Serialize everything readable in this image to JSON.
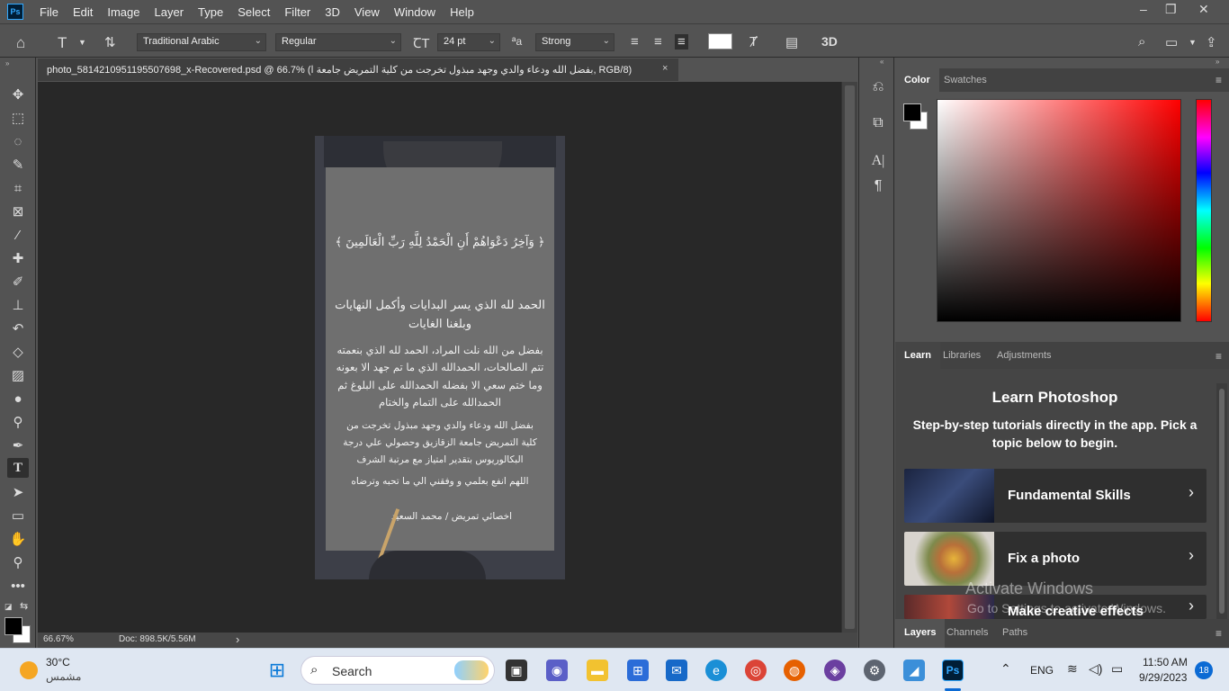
{
  "app": {
    "logo": "Ps",
    "menu": [
      "File",
      "Edit",
      "Image",
      "Layer",
      "Type",
      "Select",
      "Filter",
      "3D",
      "View",
      "Window",
      "Help"
    ],
    "window_controls": [
      "–",
      "❐",
      "✕"
    ]
  },
  "options_bar": {
    "font_family": "Traditional Arabic",
    "font_style": "Regular",
    "font_size": "24 pt",
    "antialias": "Strong",
    "aa_icon_text": "ªa",
    "color_swatch": "#ffffff",
    "label_3d": "3D"
  },
  "document": {
    "tab_title": "photo_5814210951195507698_x-Recovered.psd  @  66.7% (بفضل الله ودعاء والدي وجهد مبذول تخرجت من  كلية التمريض جامعة ا, RGB/8)",
    "close": "×",
    "zoom": "66.67%",
    "doc_size": "Doc: 898.5K/5.56M",
    "status_arrow": "›"
  },
  "artwork": {
    "verse": "﴿ وَآخِرُ دَعْوَاهُمْ أَنِ الْحَمْدُ لِلَّهِ رَبِّ الْعَالَمِينَ ﴾",
    "para1_line1": "الحمد لله الذي يسر البدايات وأكمل النهايات",
    "para1_line2": "وبلغنا الغايات",
    "para2_line1": "بفضل من الله نلت المراد، الحمد لله الذي بنعمته",
    "para2_line2": "تتم الصالحات، الحمدالله الذي ما تم جهد الا بعونه",
    "para2_line3": "وما ختم سعي الا بفضله الحمدالله على البلوغ ثم",
    "para2_line4": "الحمدالله على التمام والختام",
    "para3_line1": "بفضل الله ودعاء والدي وجهد مبذول تخرجت من",
    "para3_line2": "كلية التمريض جامعة الزقازيق وحصولي علي درجة",
    "para3_line3": "البكالوريوس بتقدير امتياز مع مرتبة الشرف",
    "prayer": "اللهم انفع بعلمي و وفقني الي ما تحبه وترضاه",
    "signature": "اخصائي تمريض / محمد السعيد"
  },
  "color_panel": {
    "tabs": [
      "Color",
      "Swatches"
    ],
    "foreground": "#000000",
    "background": "#ffffff"
  },
  "learn_panel": {
    "tabs": [
      "Learn",
      "Libraries",
      "Adjustments"
    ],
    "title": "Learn Photoshop",
    "subtitle": "Step-by-step tutorials directly in the app. Pick a topic below to begin.",
    "cards": [
      {
        "label": "Fundamental Skills",
        "chevron": "›"
      },
      {
        "label": "Fix a photo",
        "chevron": "›"
      },
      {
        "label": "Make creative effects",
        "chevron": "›"
      }
    ],
    "watermark_title": "Activate Windows",
    "watermark_sub": "Go to Settings to activate Windows."
  },
  "layers_panel": {
    "tabs": [
      "Layers",
      "Channels",
      "Paths"
    ]
  },
  "taskbar": {
    "weather_temp": "30°C",
    "weather_desc": "مشمس",
    "search_label": "Search",
    "language": "ENG",
    "time": "11:50 AM",
    "date": "9/29/2023",
    "notification_count": "18"
  }
}
